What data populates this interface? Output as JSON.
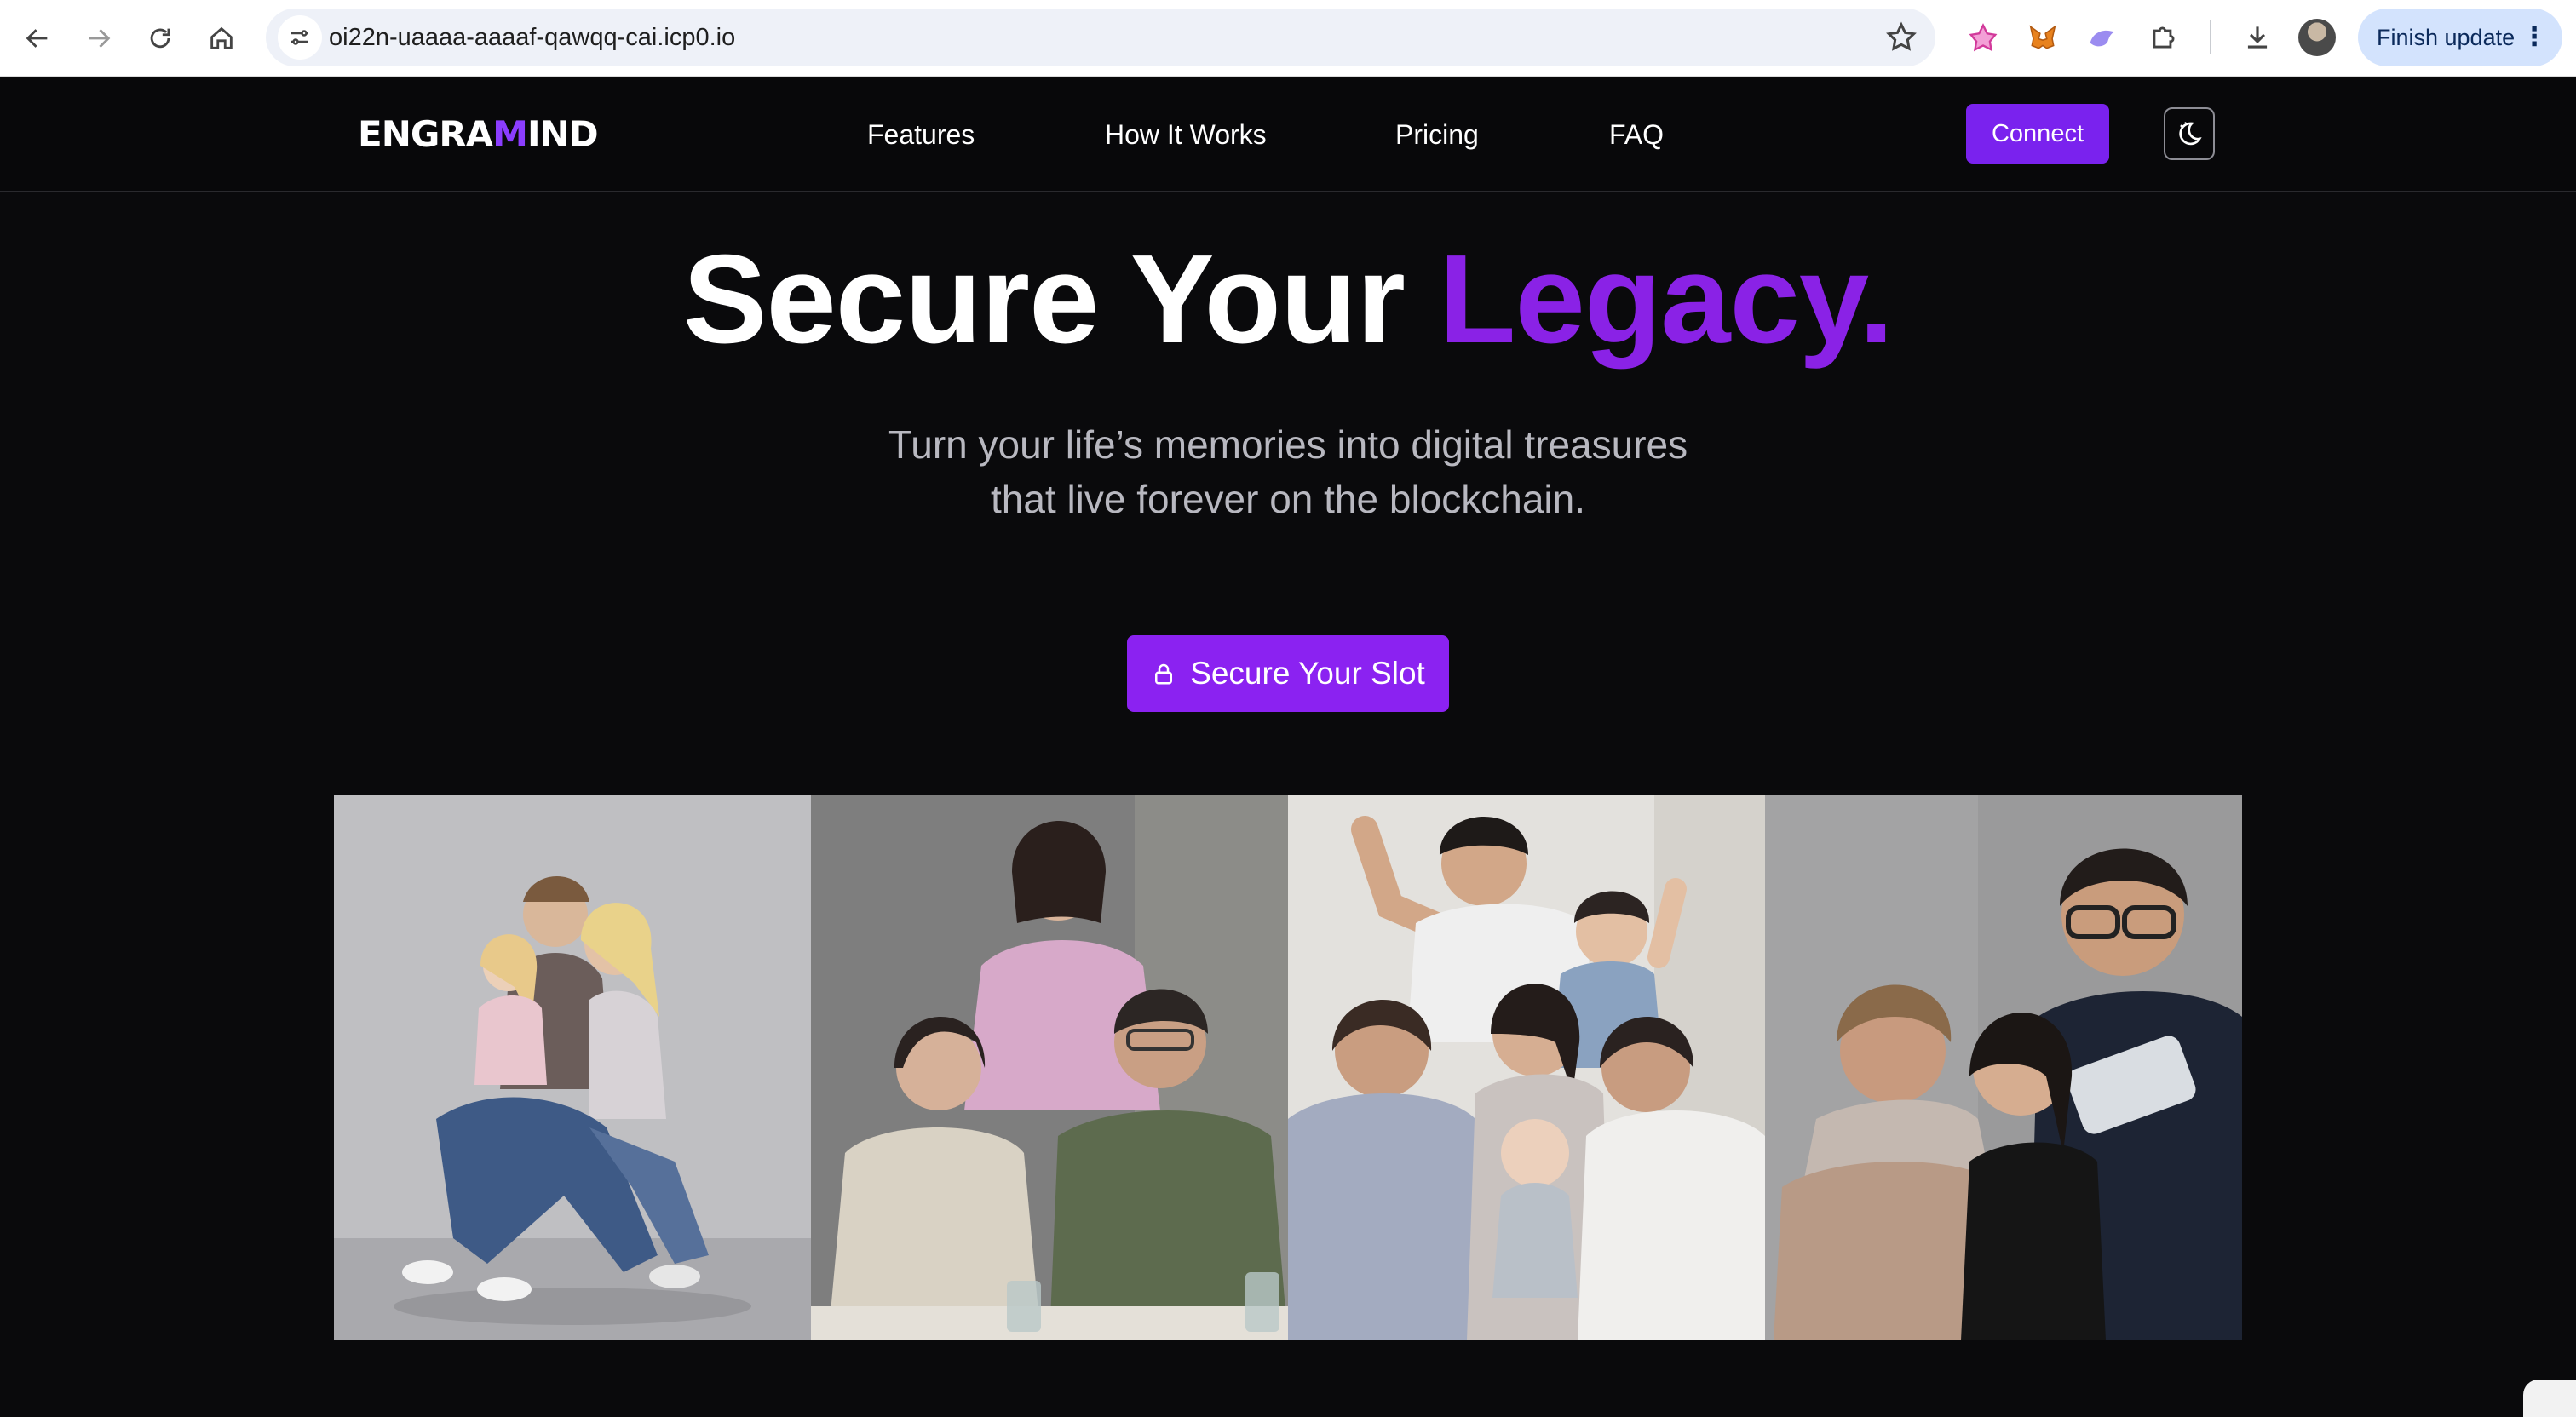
{
  "browser": {
    "url": "oi22n-uaaaa-aaaaf-qawqq-cai.icp0.io",
    "finish_update_label": "Finish update",
    "icons": [
      "back-icon",
      "forward-icon",
      "reload-icon",
      "home-icon",
      "site-settings-icon",
      "bookmark-star-icon",
      "extension-pink-icon",
      "metamask-icon",
      "extension-purple-icon",
      "extensions-puzzle-icon",
      "download-icon",
      "profile-avatar",
      "more-menu-icon"
    ]
  },
  "site": {
    "logo": {
      "text_main": "ENGRA",
      "text_accent": "M",
      "text_end": "IND"
    },
    "nav": [
      {
        "label": "Features"
      },
      {
        "label": "How It Works"
      },
      {
        "label": "Pricing"
      },
      {
        "label": "FAQ"
      }
    ],
    "connect_label": "Connect",
    "theme_toggle_icon": "moon-icon"
  },
  "hero": {
    "title_part1": "Secure Your ",
    "title_part2": "Legacy.",
    "subtitle_line1": "Turn your life’s memories into digital treasures",
    "subtitle_line2": "that live forever on the blockchain.",
    "cta_label": "Secure Your Slot",
    "cta_icon": "lock-icon"
  },
  "colors": {
    "accent": "#8b22f1",
    "title_accent": "#8a22e6",
    "background": "#0a0a0c",
    "subtitle": "#b8b8c0"
  },
  "photos": [
    {
      "name": "family-photo-1"
    },
    {
      "name": "family-photo-2"
    },
    {
      "name": "family-photo-3"
    },
    {
      "name": "family-photo-4"
    }
  ]
}
